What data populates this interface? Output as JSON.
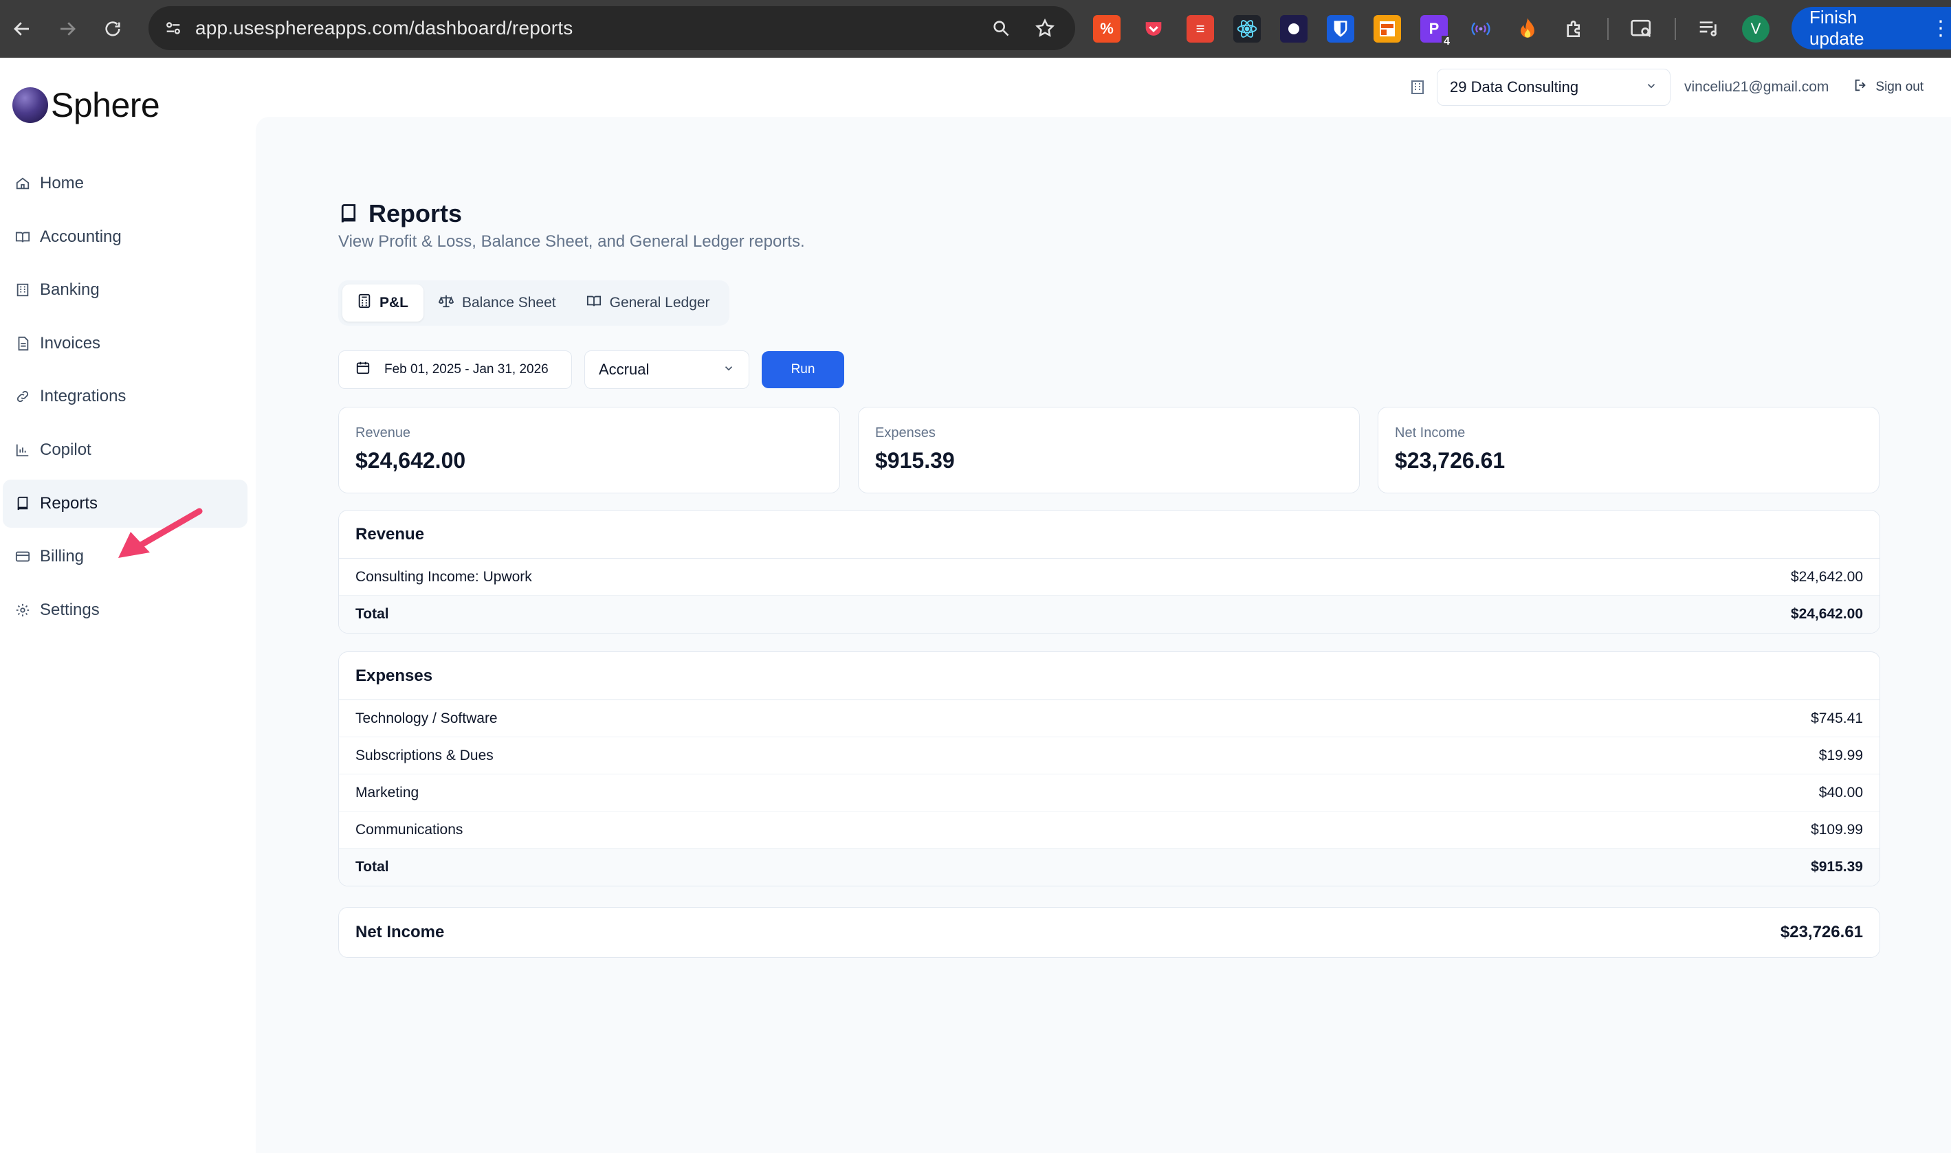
{
  "browser": {
    "url": "app.usesphereapps.com/dashboard/reports",
    "finish_update": "Finish update",
    "profile_initial": "V",
    "extension_badge_count": "4"
  },
  "app": {
    "brand": "Sphere",
    "org_select": "29 Data Consulting",
    "email": "vinceliu21@gmail.com",
    "sign_out": "Sign out"
  },
  "sidebar": {
    "items": [
      {
        "label": "Home",
        "icon": "home-icon"
      },
      {
        "label": "Accounting",
        "icon": "book-open-icon"
      },
      {
        "label": "Banking",
        "icon": "bank-icon"
      },
      {
        "label": "Invoices",
        "icon": "file-text-icon"
      },
      {
        "label": "Integrations",
        "icon": "link-icon"
      },
      {
        "label": "Copilot",
        "icon": "bar-chart-icon"
      },
      {
        "label": "Reports",
        "icon": "book-icon",
        "active": true
      },
      {
        "label": "Billing",
        "icon": "credit-card-icon"
      },
      {
        "label": "Settings",
        "icon": "gear-icon"
      }
    ]
  },
  "page": {
    "title": "Reports",
    "subtitle": "View Profit & Loss, Balance Sheet, and General Ledger reports.",
    "tabs": [
      {
        "label": "P&L",
        "active": true
      },
      {
        "label": "Balance Sheet"
      },
      {
        "label": "General Ledger"
      }
    ],
    "date_range": "Feb 01, 2025 - Jan 31, 2026",
    "basis": "Accrual",
    "run_label": "Run"
  },
  "summary": [
    {
      "label": "Revenue",
      "value": "$24,642.00"
    },
    {
      "label": "Expenses",
      "value": "$915.39"
    },
    {
      "label": "Net Income",
      "value": "$23,726.61"
    }
  ],
  "revenue": {
    "title": "Revenue",
    "rows": [
      {
        "name": "Consulting Income: Upwork",
        "amount": "$24,642.00"
      }
    ],
    "total_label": "Total",
    "total": "$24,642.00"
  },
  "expenses": {
    "title": "Expenses",
    "rows": [
      {
        "name": "Technology / Software",
        "amount": "$745.41"
      },
      {
        "name": "Subscriptions & Dues",
        "amount": "$19.99"
      },
      {
        "name": "Marketing",
        "amount": "$40.00"
      },
      {
        "name": "Communications",
        "amount": "$109.99"
      }
    ],
    "total_label": "Total",
    "total": "$915.39"
  },
  "net_income": {
    "label": "Net Income",
    "value": "$23,726.61"
  },
  "colors": {
    "accent": "#2563eb",
    "annotation_arrow": "#f0406c",
    "chrome_bg": "#3c3c3c"
  }
}
